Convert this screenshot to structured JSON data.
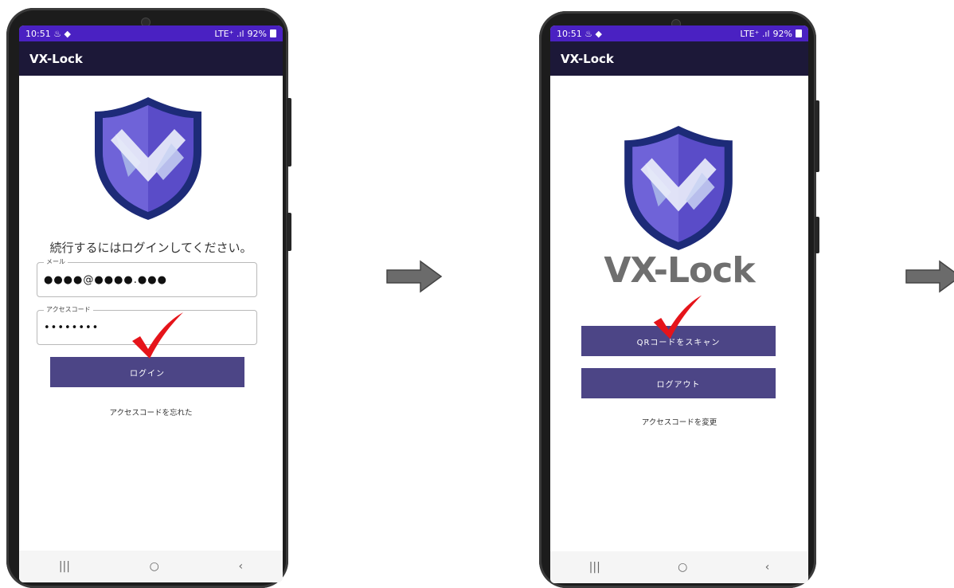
{
  "status_bar": {
    "time": "10:51",
    "left_icons": "♨ ◆",
    "signal": "LTE⁺ .ıl",
    "battery": "92%"
  },
  "app_title": "VX-Lock",
  "screen1": {
    "prompt": "続行するにはログインしてください。",
    "email": {
      "label": "メール",
      "value": "●●●●@●●●●.●●●"
    },
    "access_code": {
      "label": "アクセスコード",
      "value": "••••••••"
    },
    "login_button": "ログイン",
    "forgot_link": "アクセスコードを忘れた"
  },
  "screen2": {
    "brand_title": "VX-Lock",
    "scan_button": "QRコードをスキャン",
    "logout_button": "ログアウト",
    "change_link": "アクセスコードを変更"
  },
  "nav": {
    "recent": "|||",
    "home": "○",
    "back": "‹"
  },
  "colors": {
    "status_bar": "#4a21c2",
    "app_bar": "#1c1838",
    "button": "#4c4586",
    "check": "#e5141a",
    "arrow": "#6b6b6b"
  }
}
